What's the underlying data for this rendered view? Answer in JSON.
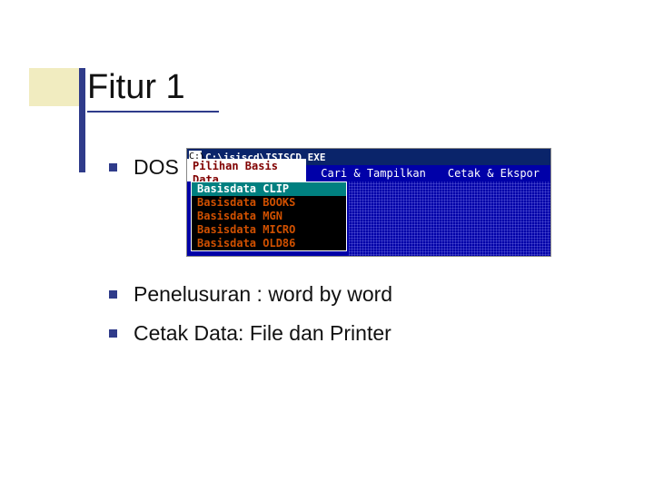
{
  "slide": {
    "title": "Fitur 1"
  },
  "bullets": {
    "b1": "DOS",
    "b2": "Penelusuran : word by word",
    "b3": "Cetak Data: File dan Printer"
  },
  "dos": {
    "icon_glyph": "C:\\",
    "title": "C:\\isiscd\\ISISCD.EXE",
    "menu": {
      "active": "Pilihan Basis Data",
      "m2": "Cari & Tampilkan",
      "m3": "Cetak & Ekspor"
    },
    "dropdown": {
      "i0": "Basisdata CLIP",
      "i1": "Basisdata BOOKS",
      "i2": "Basisdata MGN",
      "i3": "Basisdata MICRO",
      "i4": "Basisdata OLD86"
    }
  }
}
